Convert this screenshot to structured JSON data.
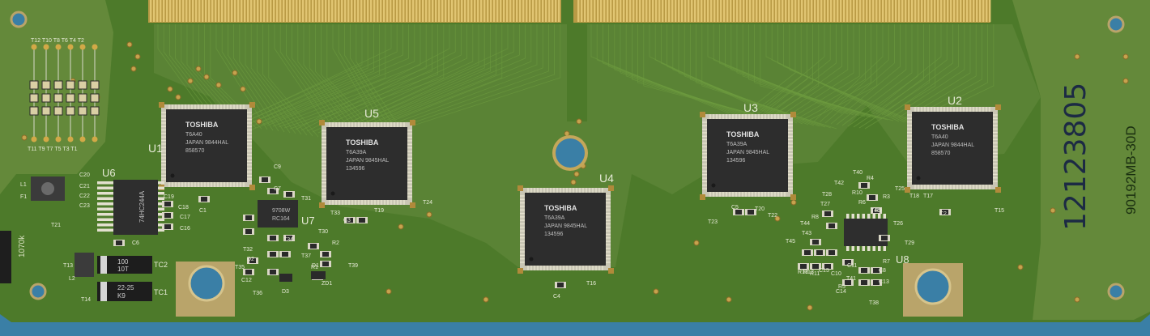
{
  "board": {
    "background_color": "#3a7fa6",
    "pcb_color": "#4d7a2a",
    "pcb_light_color": "#6f9437",
    "gold_color": "#c9a84a",
    "chip_color": "#2b2b2b"
  },
  "chips": [
    {
      "ref": "U1",
      "brand": "TOSHIBA",
      "part": "T6A40",
      "line3": "JAPAN 9844HAL",
      "line4": "858570"
    },
    {
      "ref": "U5",
      "brand": "TOSHIBA",
      "part": "T6A39A",
      "line3": "JAPAN 9845HAL",
      "line4": "134596"
    },
    {
      "ref": "U4",
      "brand": "TOSHIBA",
      "part": "T6A39A",
      "line3": "JAPAN 9845HAL",
      "line4": "134596"
    },
    {
      "ref": "U3",
      "brand": "TOSHIBA",
      "part": "T6A39A",
      "line3": "JAPAN 9845HAL",
      "line4": "134596"
    },
    {
      "ref": "U2",
      "brand": "TOSHIBA",
      "part": "T6A40",
      "line3": "JAPAN 9844HAL",
      "line4": "858570"
    }
  ],
  "small_ics": {
    "u6": {
      "ref": "U6",
      "marking": "74HC244A"
    },
    "u7": {
      "ref": "U7",
      "line1": "9708W",
      "line2": "RC164"
    },
    "u8": {
      "ref": "U8"
    }
  },
  "capacitors": {
    "tc2": {
      "ref": "TC2",
      "line1": "100",
      "line2": "10T"
    },
    "tc1": {
      "ref": "TC1",
      "line1": "22-25",
      "line2": "K9"
    }
  },
  "board_markings": {
    "part_number": "90192MB-30D",
    "handwritten": "12123805",
    "side_label": "1070k"
  },
  "test_points_top": [
    "T12",
    "T10",
    "T8",
    "T6",
    "T4",
    "T2"
  ],
  "test_points_bottom": [
    "T11",
    "T9",
    "T7",
    "T5",
    "T3",
    "T1"
  ],
  "component_labels": [
    "C20",
    "C21",
    "C22",
    "C23",
    "C19",
    "C18",
    "C17",
    "C16",
    "C6",
    "C1",
    "C2",
    "C3",
    "C4",
    "C5",
    "C7",
    "C8",
    "C9",
    "C10",
    "C11",
    "C12",
    "C13",
    "C14",
    "C15",
    "R1",
    "R2",
    "R3",
    "R4",
    "R5",
    "R6",
    "R7",
    "R8",
    "R9",
    "R10",
    "R11",
    "R12",
    "R13",
    "D1",
    "D2",
    "D3",
    "ZD1",
    "L1",
    "L2",
    "F1",
    "T13",
    "T14",
    "T15",
    "T16",
    "T17",
    "T18",
    "T19",
    "T20",
    "T21",
    "T22",
    "T23",
    "T24",
    "T25",
    "T26",
    "T27",
    "T28",
    "T29",
    "T30",
    "T31",
    "T32",
    "T33",
    "T34",
    "T35",
    "T36",
    "T37",
    "T38",
    "T39",
    "T40",
    "T41",
    "T42",
    "T43",
    "T44",
    "T45",
    "T46"
  ]
}
